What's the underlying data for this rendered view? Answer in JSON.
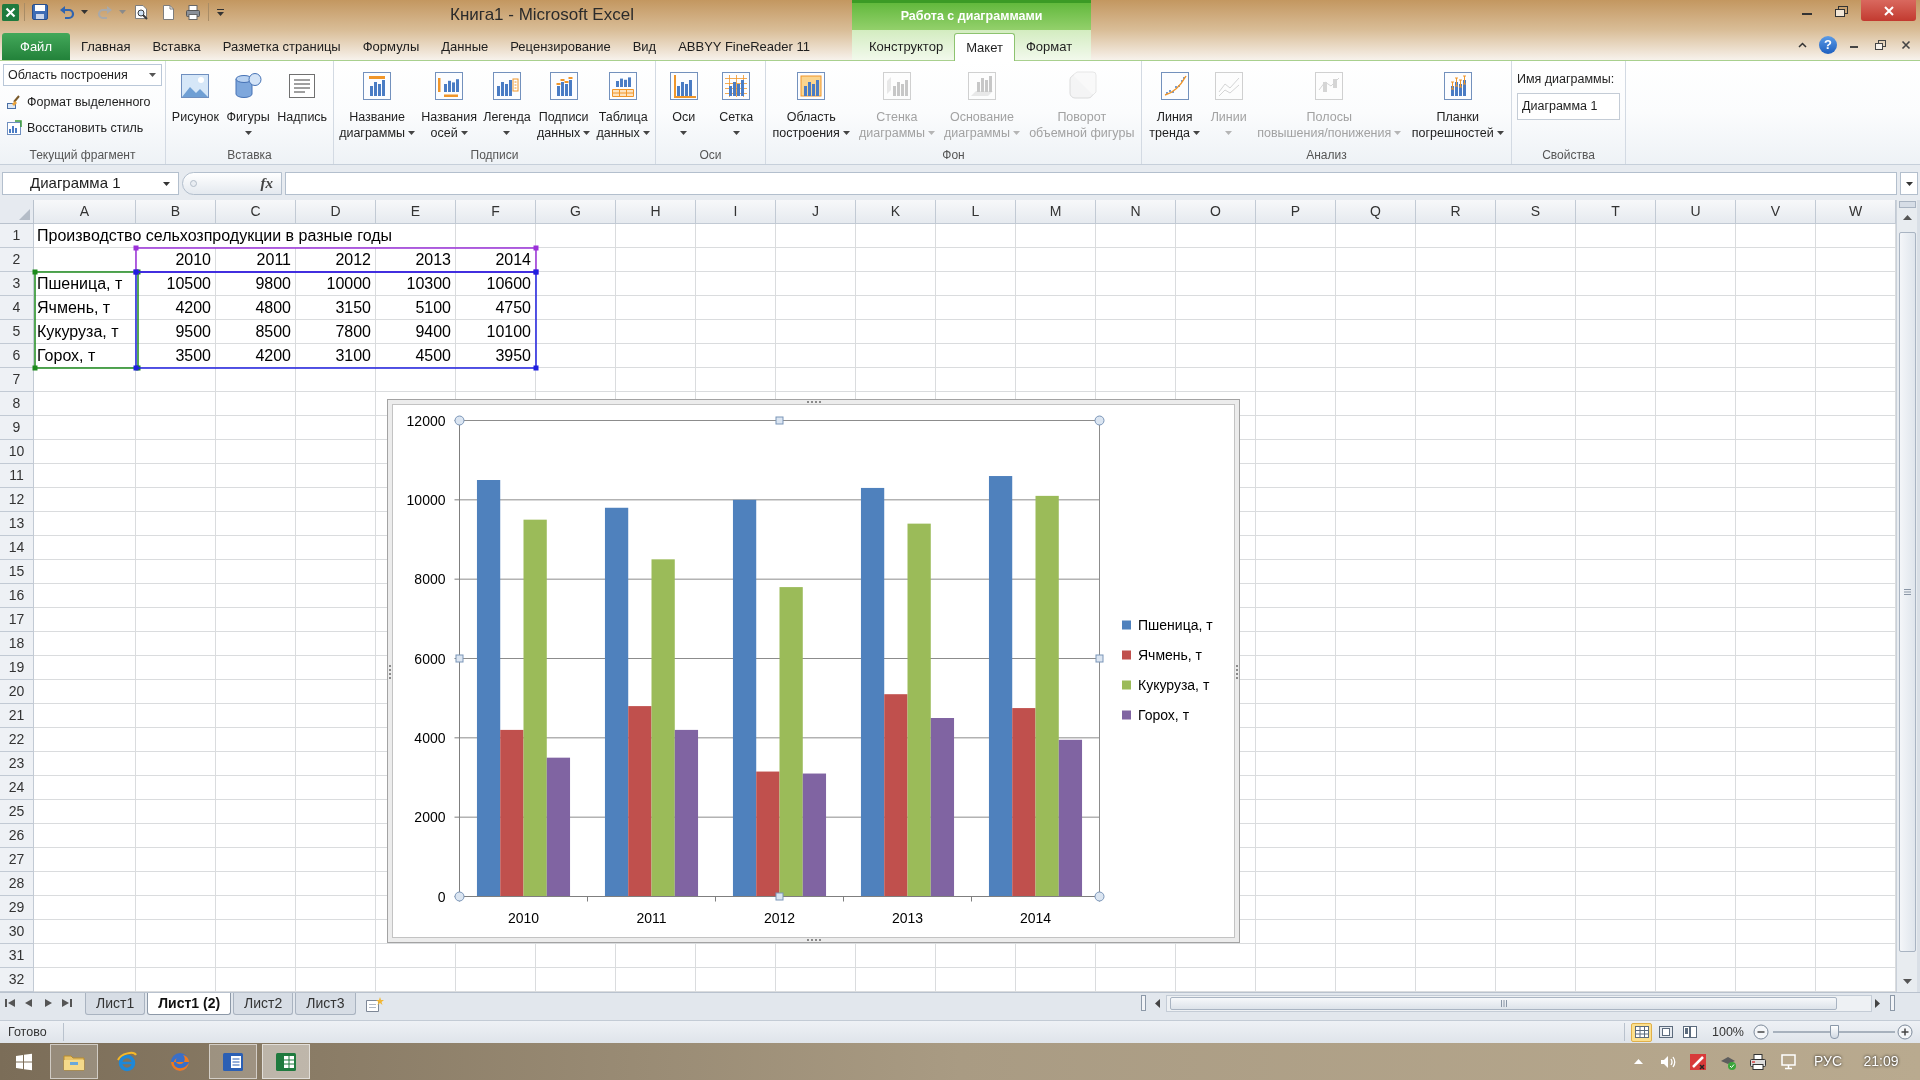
{
  "window": {
    "title": "Книга1 - Microsoft Excel",
    "context_title": "Работа с диаграммами",
    "help_label": "?"
  },
  "ribbon_tabs": [
    {
      "label": "Файл",
      "kind": "file",
      "selected": false
    },
    {
      "label": "Главная",
      "kind": "standard",
      "selected": false
    },
    {
      "label": "Вставка",
      "kind": "standard",
      "selected": false
    },
    {
      "label": "Разметка страницы",
      "kind": "standard",
      "selected": false
    },
    {
      "label": "Формулы",
      "kind": "standard",
      "selected": false
    },
    {
      "label": "Данные",
      "kind": "standard",
      "selected": false
    },
    {
      "label": "Рецензирование",
      "kind": "standard",
      "selected": false
    },
    {
      "label": "Вид",
      "kind": "standard",
      "selected": false
    },
    {
      "label": "ABBYY FineReader 11",
      "kind": "standard",
      "selected": false
    },
    {
      "label": "Конструктор",
      "kind": "contextual",
      "selected": false
    },
    {
      "label": "Макет",
      "kind": "contextual",
      "selected": true
    },
    {
      "label": "Формат",
      "kind": "contextual",
      "selected": false
    }
  ],
  "ribbon_groups": [
    {
      "kind": "selection",
      "label": "Текущий фрагмент",
      "dropdown_value": "Область построения",
      "commands": [
        "Формат выделенного",
        "Восстановить стиль"
      ]
    },
    {
      "kind": "buttons",
      "label": "Вставка",
      "buttons": [
        {
          "label": "Рисунок",
          "dropdown": false,
          "disabled": false
        },
        {
          "label": "Фигуры",
          "dropdown": true,
          "disabled": false
        },
        {
          "label": "Надпись",
          "dropdown": false,
          "disabled": false
        }
      ]
    },
    {
      "kind": "buttons",
      "label": "Подписи",
      "buttons": [
        {
          "label": "Название диаграммы",
          "dropdown": true,
          "disabled": false
        },
        {
          "label": "Названия осей",
          "dropdown": true,
          "disabled": false
        },
        {
          "label": "Легенда",
          "dropdown": true,
          "disabled": false
        },
        {
          "label": "Подписи данных",
          "dropdown": true,
          "disabled": false
        },
        {
          "label": "Таблица данных",
          "dropdown": true,
          "disabled": false
        }
      ]
    },
    {
      "kind": "buttons",
      "label": "Оси",
      "buttons": [
        {
          "label": "Оси",
          "dropdown": true,
          "disabled": false
        },
        {
          "label": "Сетка",
          "dropdown": true,
          "disabled": false
        }
      ]
    },
    {
      "kind": "buttons",
      "label": "Фон",
      "buttons": [
        {
          "label": "Область построения",
          "dropdown": true,
          "disabled": false
        },
        {
          "label": "Стенка диаграммы",
          "dropdown": true,
          "disabled": true
        },
        {
          "label": "Основание диаграммы",
          "dropdown": true,
          "disabled": true
        },
        {
          "label": "Поворот объемной фигуры",
          "dropdown": false,
          "disabled": true
        }
      ]
    },
    {
      "kind": "buttons",
      "label": "Анализ",
      "buttons": [
        {
          "label": "Линия тренда",
          "dropdown": true,
          "disabled": false
        },
        {
          "label": "Линии",
          "dropdown": true,
          "disabled": true
        },
        {
          "label": "Полосы повышения/понижения",
          "dropdown": true,
          "disabled": true
        },
        {
          "label": "Планки погрешностей",
          "dropdown": true,
          "disabled": false
        }
      ]
    },
    {
      "kind": "properties",
      "label": "Свойства",
      "field_label": "Имя диаграммы:",
      "field_value": "Диаграмма 1"
    }
  ],
  "formula_bar": {
    "name_box": "Диаграмма 1",
    "function_label": "fx"
  },
  "sheet": {
    "columns": [
      "A",
      "B",
      "C",
      "D",
      "E",
      "F",
      "G",
      "H",
      "I",
      "J",
      "K",
      "L",
      "M",
      "N",
      "O",
      "P",
      "Q",
      "R",
      "S",
      "T",
      "U",
      "V",
      "W"
    ],
    "rows": [
      "1",
      "2",
      "3",
      "4",
      "5",
      "6",
      "7",
      "8",
      "9",
      "10",
      "11",
      "12",
      "13",
      "14",
      "15",
      "16",
      "17",
      "18",
      "19",
      "20",
      "21",
      "22",
      "23",
      "24",
      "25",
      "26",
      "27",
      "28",
      "29",
      "30",
      "31",
      "32"
    ],
    "title": "Производство сельхозпродукции в разные годы",
    "header": [
      "2010",
      "2011",
      "2012",
      "2013",
      "2014"
    ],
    "data_rows": [
      {
        "label": "Пшеница, т",
        "values": [
          "10500",
          "9800",
          "10000",
          "10300",
          "10600"
        ]
      },
      {
        "label": "Ячмень, т",
        "values": [
          "4200",
          "4800",
          "3150",
          "5100",
          "4750"
        ]
      },
      {
        "label": "Кукуруза, т",
        "values": [
          "9500",
          "8500",
          "7800",
          "9400",
          "10100"
        ]
      },
      {
        "label": "Горох, т",
        "values": [
          "3500",
          "4200",
          "3100",
          "4500",
          "3950"
        ]
      }
    ]
  },
  "chart": {
    "selected": true,
    "chart_data": {
      "type": "bar",
      "categories": [
        "2010",
        "2011",
        "2012",
        "2013",
        "2014"
      ],
      "series": [
        {
          "name": "Пшеница, т",
          "color": "#4f81bd",
          "values": [
            10500,
            9800,
            10000,
            10300,
            10600
          ]
        },
        {
          "name": "Ячмень, т",
          "color": "#c0504d",
          "values": [
            4200,
            4800,
            3150,
            5100,
            4750
          ]
        },
        {
          "name": "Кукуруза, т",
          "color": "#9bbb59",
          "values": [
            9500,
            8500,
            7800,
            9400,
            10100
          ]
        },
        {
          "name": "Горох, т",
          "color": "#8064a2",
          "values": [
            3500,
            4200,
            3100,
            4500,
            3950
          ]
        }
      ],
      "ylim": [
        0,
        12000
      ],
      "yticks": [
        {
          "value": 0,
          "label": "0"
        },
        {
          "value": 2000,
          "label": "2000"
        },
        {
          "value": 4000,
          "label": "4000"
        },
        {
          "value": 6000,
          "label": "6000"
        },
        {
          "value": 8000,
          "label": "8000"
        },
        {
          "value": 10000,
          "label": "10000"
        },
        {
          "value": 12000,
          "label": "12000"
        }
      ],
      "grid": true,
      "legend": "right"
    }
  },
  "sheet_tabs": [
    {
      "label": "Лист1",
      "selected": false
    },
    {
      "label": "Лист1 (2)",
      "selected": true
    },
    {
      "label": "Лист2",
      "selected": false
    },
    {
      "label": "Лист3",
      "selected": false
    }
  ],
  "status_bar": {
    "status": "Готово",
    "views": [
      {
        "kind": "normal",
        "selected": true
      },
      {
        "kind": "page_layout",
        "selected": false
      },
      {
        "kind": "page_break",
        "selected": false
      }
    ],
    "zoom": "100%",
    "zoom_slider": {
      "level": 0.5
    }
  },
  "taskbar": {
    "apps": [
      {
        "kind": "explorer",
        "running": true,
        "selected": false
      },
      {
        "kind": "ie",
        "running": false,
        "selected": false
      },
      {
        "kind": "firefox",
        "running": false,
        "selected": false
      },
      {
        "kind": "word",
        "running": true,
        "selected": false
      },
      {
        "kind": "excel",
        "running": true,
        "selected": true
      }
    ],
    "tray": {
      "language": "РУС",
      "time": "21:09"
    }
  }
}
